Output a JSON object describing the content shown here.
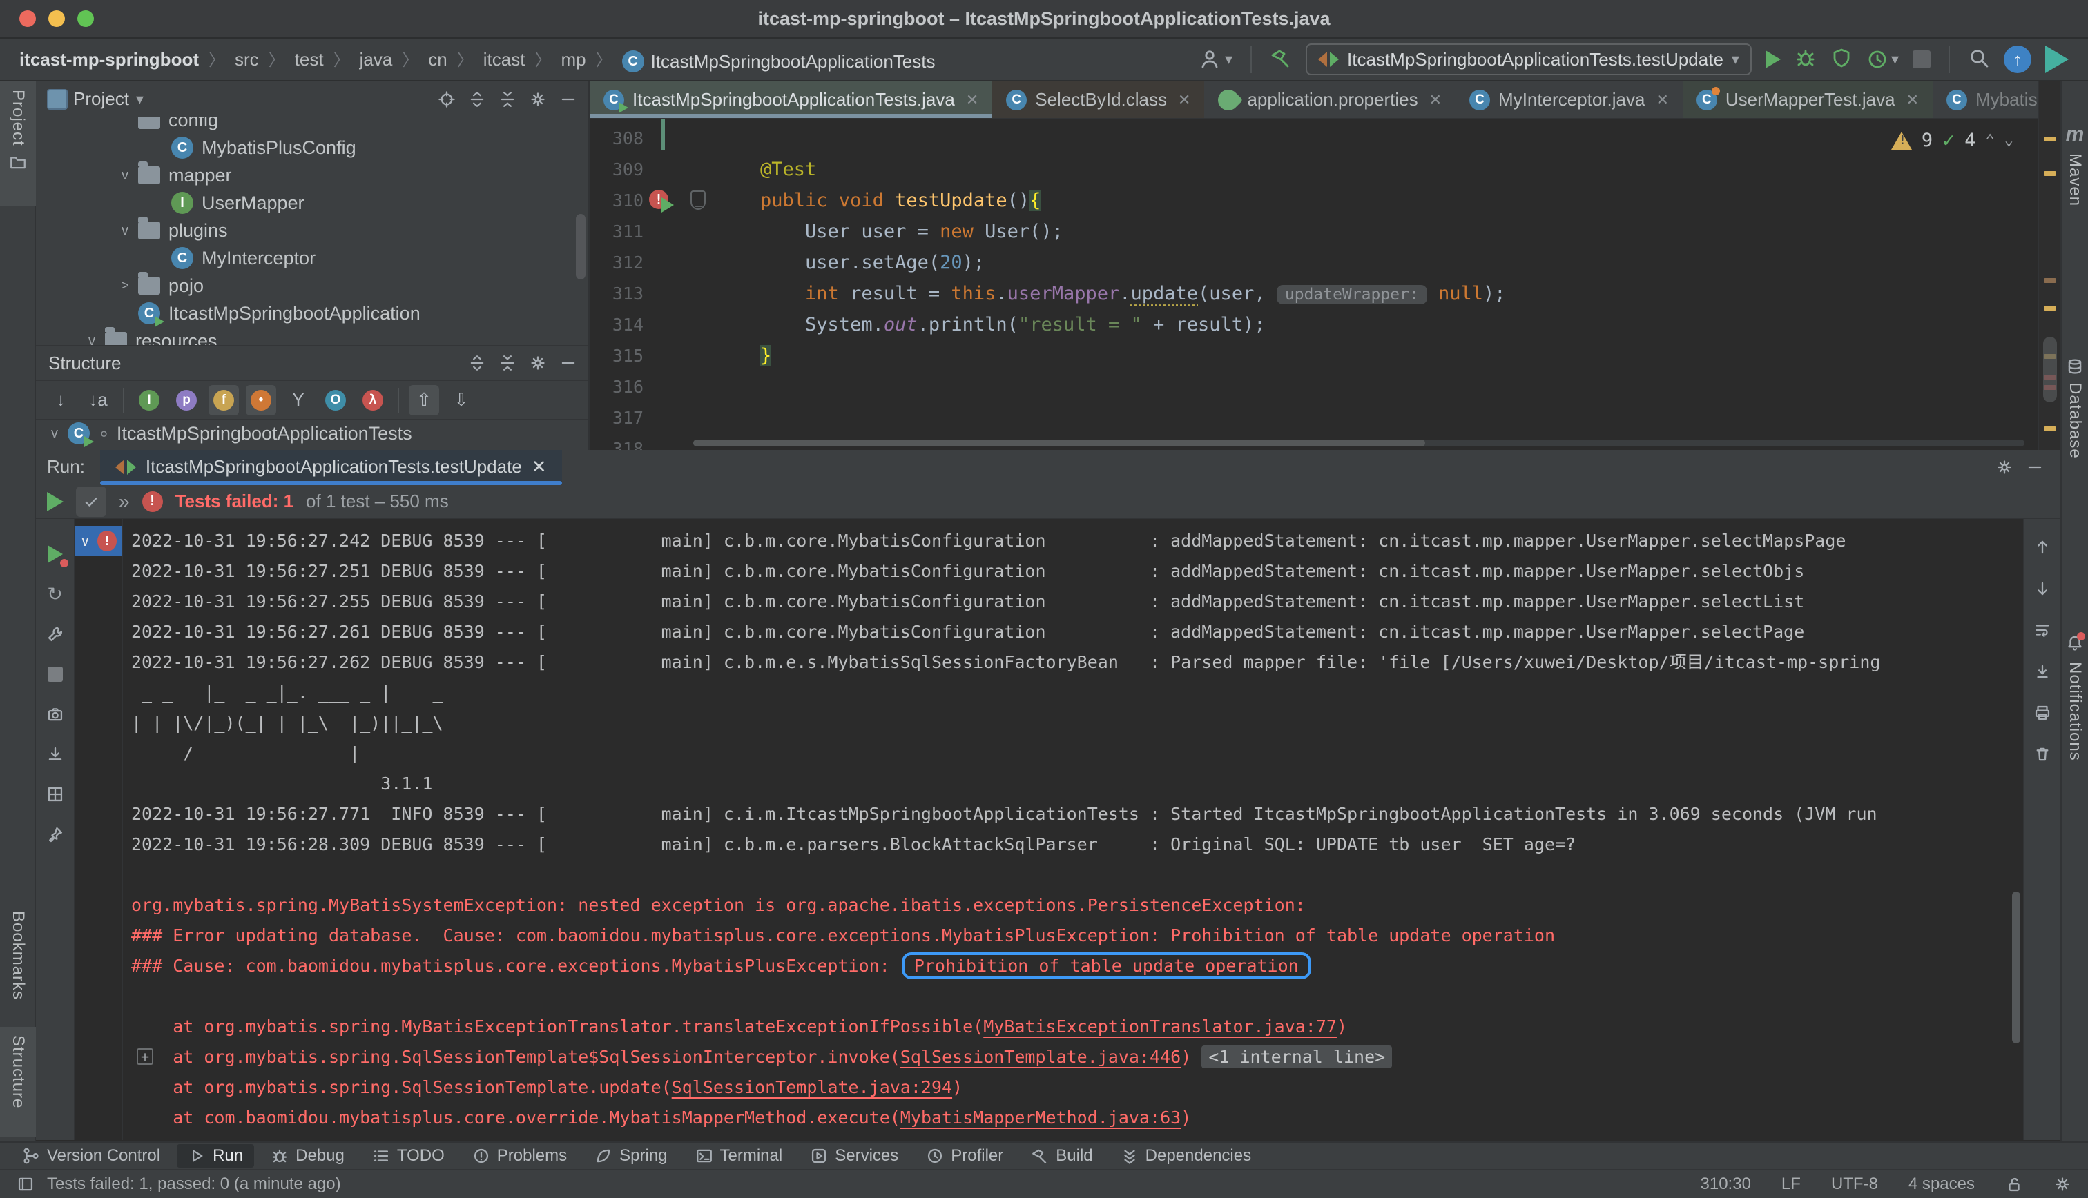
{
  "window": {
    "title": "itcast-mp-springboot – ItcastMpSpringbootApplicationTests.java"
  },
  "breadcrumb": {
    "root": "itcast-mp-springboot",
    "items": [
      "src",
      "test",
      "java",
      "cn",
      "itcast",
      "mp"
    ],
    "leaf": "ItcastMpSpringbootApplicationTests"
  },
  "toolbar": {
    "run_config": "ItcastMpSpringbootApplicationTests.testUpdate"
  },
  "left_stripe": {
    "project": "Project",
    "bookmarks": "Bookmarks",
    "structure": "Structure"
  },
  "right_stripe": {
    "maven_glyph": "m",
    "maven": "Maven",
    "database": "Database",
    "notifications": "Notifications"
  },
  "project_panel": {
    "title": "Project",
    "tree": [
      {
        "label": "config",
        "icon": "folder",
        "depth": 2,
        "chevron": "",
        "cut": true
      },
      {
        "label": "MybatisPlusConfig",
        "icon": "class",
        "depth": 3,
        "chevron": ""
      },
      {
        "label": "mapper",
        "icon": "folder",
        "depth": 2,
        "chevron": "v"
      },
      {
        "label": "UserMapper",
        "icon": "interface",
        "depth": 3,
        "chevron": ""
      },
      {
        "label": "plugins",
        "icon": "folder",
        "depth": 2,
        "chevron": "v"
      },
      {
        "label": "MyInterceptor",
        "icon": "class",
        "depth": 3,
        "chevron": ""
      },
      {
        "label": "pojo",
        "icon": "folder",
        "depth": 2,
        "chevron": ">"
      },
      {
        "label": "ItcastMpSpringbootApplication",
        "icon": "springboot",
        "depth": 2,
        "chevron": ""
      },
      {
        "label": "resources",
        "icon": "resources",
        "depth": 1,
        "chevron": "v"
      }
    ]
  },
  "structure_panel": {
    "title": "Structure",
    "root": "ItcastMpSpringbootApplicationTests",
    "filters": [
      {
        "name": "sort-by-visibility",
        "kind": "glyph",
        "glyph": "↓",
        "active": false
      },
      {
        "name": "sort-alphabetically",
        "kind": "glyph",
        "glyph": "↓a",
        "active": false
      },
      {
        "name": "sep1",
        "kind": "sep"
      },
      {
        "name": "show-inherited",
        "kind": "circle",
        "letter": "I",
        "bg": "#5f9955",
        "active": false
      },
      {
        "name": "show-properties",
        "kind": "circle",
        "letter": "p",
        "bg": "#8e7cc3",
        "active": false
      },
      {
        "name": "show-fields",
        "kind": "circle",
        "letter": "f",
        "bg": "#c8a452",
        "active": true
      },
      {
        "name": "show-non-public",
        "kind": "circle",
        "letter": "•",
        "bg": "#cf7836",
        "active": true
      },
      {
        "name": "show-anonymous",
        "kind": "glyph",
        "glyph": "Y",
        "active": false
      },
      {
        "name": "show-objects",
        "kind": "circle",
        "letter": "O",
        "bg": "#3f8ea8",
        "active": false
      },
      {
        "name": "show-lambdas",
        "kind": "circle",
        "letter": "λ",
        "bg": "#c75450",
        "active": false
      },
      {
        "name": "sep2",
        "kind": "sep"
      },
      {
        "name": "group-by-super",
        "kind": "glyph",
        "glyph": "⇧",
        "active": true
      },
      {
        "name": "sort-by-type",
        "kind": "glyph",
        "glyph": "⇩",
        "active": false
      }
    ]
  },
  "editor": {
    "tabs": [
      {
        "label": "ItcastMpSpringbootApplicationTests.java",
        "icon": "testclass",
        "close": true,
        "active": true
      },
      {
        "label": "SelectById.class",
        "icon": "class",
        "close": true,
        "tint": "warm"
      },
      {
        "label": "application.properties",
        "icon": "spring",
        "close": true
      },
      {
        "label": "MyInterceptor.java",
        "icon": "class",
        "close": true
      },
      {
        "label": "UserMapperTest.java",
        "icon": "classmod",
        "close": true,
        "tint": "greenish"
      },
      {
        "label": "MybatisPlusConfig.java",
        "icon": "class",
        "close": false,
        "dim": true
      }
    ],
    "inspections": {
      "warnings": "9",
      "weak_warnings": "4"
    },
    "code_lines": [
      {
        "n": "308",
        "tokens": []
      },
      {
        "n": "309",
        "tokens": [
          {
            "k": "ann",
            "s": "    @Test"
          }
        ]
      },
      {
        "n": "310",
        "run": true,
        "fold": true,
        "chg": true,
        "tokens": [
          {
            "k": "kw",
            "s": "    public void "
          },
          {
            "k": "mth",
            "s": "testUpdate"
          },
          {
            "k": "pl",
            "s": "()"
          },
          {
            "k": "brace",
            "s": "{"
          }
        ]
      },
      {
        "n": "311",
        "chg": true,
        "tokens": [
          {
            "k": "pl",
            "s": "        User user = "
          },
          {
            "k": "kw",
            "s": "new"
          },
          {
            "k": "pl",
            "s": " User();"
          }
        ]
      },
      {
        "n": "312",
        "chg": true,
        "tokens": [
          {
            "k": "pl",
            "s": "        user.setAge("
          },
          {
            "k": "num",
            "s": "20"
          },
          {
            "k": "pl",
            "s": ");"
          }
        ]
      },
      {
        "n": "313",
        "chg": true,
        "tokens": [
          {
            "k": "kw",
            "s": "        int"
          },
          {
            "k": "pl",
            "s": " result = "
          },
          {
            "k": "kw",
            "s": "this"
          },
          {
            "k": "pl",
            "s": "."
          },
          {
            "k": "fld",
            "s": "userMapper"
          },
          {
            "k": "pl",
            "s": "."
          },
          {
            "k": "warn",
            "s": "update"
          },
          {
            "k": "pl",
            "s": "(user, "
          },
          {
            "k": "hint",
            "s": "updateWrapper:"
          },
          {
            "k": "pl",
            "s": " "
          },
          {
            "k": "kw",
            "s": "null"
          },
          {
            "k": "pl",
            "s": ");"
          }
        ]
      },
      {
        "n": "314",
        "chg": true,
        "tokens": [
          {
            "k": "pl",
            "s": "        System."
          },
          {
            "k": "fldi",
            "s": "out"
          },
          {
            "k": "pl",
            "s": ".println("
          },
          {
            "k": "str",
            "s": "\"result = \""
          },
          {
            "k": "pl",
            "s": " + result);"
          }
        ]
      },
      {
        "n": "315",
        "chg": true,
        "tokens": [
          {
            "k": "pl",
            "s": "    "
          },
          {
            "k": "brace",
            "s": "}"
          }
        ]
      },
      {
        "n": "316",
        "tokens": []
      },
      {
        "n": "317",
        "tokens": []
      },
      {
        "n": "318",
        "tokens": []
      }
    ]
  },
  "run_panel": {
    "label": "Run:",
    "tab": "ItcastMpSpringbootApplicationTests.testUpdate",
    "status_failed": "Tests failed: 1",
    "status_rest": "of 1 test – 550 ms",
    "left_icons": [
      "rerun-failed-tests",
      "rerun",
      "test-settings",
      "stop",
      "test-history",
      "import-results",
      "layout",
      "pin"
    ],
    "right_icons": [
      "scroll-up",
      "scroll-down",
      "soft-wrap",
      "scroll-to-end",
      "print",
      "clear-all"
    ],
    "console_lines": [
      {
        "parts": [
          {
            "k": "t",
            "s": "2022-10-31 19:56:27.242 DEBUG 8539 --- [           main] c.b.m.core.MybatisConfiguration          : addMappedStatement: cn.itcast.mp.mapper.UserMapper.selectMapsPage"
          }
        ]
      },
      {
        "parts": [
          {
            "k": "t",
            "s": "2022-10-31 19:56:27.251 DEBUG 8539 --- [           main] c.b.m.core.MybatisConfiguration          : addMappedStatement: cn.itcast.mp.mapper.UserMapper.selectObjs"
          }
        ]
      },
      {
        "parts": [
          {
            "k": "t",
            "s": "2022-10-31 19:56:27.255 DEBUG 8539 --- [           main] c.b.m.core.MybatisConfiguration          : addMappedStatement: cn.itcast.mp.mapper.UserMapper.selectList"
          }
        ]
      },
      {
        "parts": [
          {
            "k": "t",
            "s": "2022-10-31 19:56:27.261 DEBUG 8539 --- [           main] c.b.m.core.MybatisConfiguration          : addMappedStatement: cn.itcast.mp.mapper.UserMapper.selectPage"
          }
        ]
      },
      {
        "parts": [
          {
            "k": "t",
            "s": "2022-10-31 19:56:27.262 DEBUG 8539 --- [           main] c.b.m.e.s.MybatisSqlSessionFactoryBean   : Parsed mapper file: 'file [/Users/xuwei/Desktop/项目/itcast-mp-spring"
          }
        ]
      },
      {
        "parts": [
          {
            "k": "t",
            "s": " _ _   |_  _ _|_. ___ _ |    _ "
          }
        ]
      },
      {
        "parts": [
          {
            "k": "t",
            "s": "| | |\\/|_)(_| | |_\\  |_)||_|_\\ "
          }
        ]
      },
      {
        "parts": [
          {
            "k": "t",
            "s": "     /               |         "
          }
        ]
      },
      {
        "parts": [
          {
            "k": "t",
            "s": "                        3.1.1 "
          }
        ]
      },
      {
        "parts": [
          {
            "k": "t",
            "s": "2022-10-31 19:56:27.771  INFO 8539 --- [           main] c.i.m.ItcastMpSpringbootApplicationTests : Started ItcastMpSpringbootApplicationTests in 3.069 seconds (JVM run"
          }
        ]
      },
      {
        "parts": [
          {
            "k": "t",
            "s": "2022-10-31 19:56:28.309 DEBUG 8539 --- [           main] c.b.m.e.parsers.BlockAttackSqlParser     : Original SQL: UPDATE tb_user  SET age=?"
          }
        ]
      },
      {
        "parts": []
      },
      {
        "parts": [
          {
            "k": "e",
            "s": "org.mybatis.spring.MyBatisSystemException: nested exception is org.apache.ibatis.exceptions.PersistenceException: "
          }
        ]
      },
      {
        "parts": [
          {
            "k": "e",
            "s": "### Error updating database.  Cause: com.baomidou.mybatisplus.core.exceptions.MybatisPlusException: Prohibition of table update operation"
          }
        ]
      },
      {
        "parts": [
          {
            "k": "e",
            "s": "### Cause: com.baomidou.mybatisplus.core.exceptions.MybatisPlusException: "
          },
          {
            "k": "b",
            "s": "Prohibition of table update operation"
          }
        ]
      },
      {
        "parts": []
      },
      {
        "parts": [
          {
            "k": "e",
            "s": "    at org.mybatis.spring.MyBatisExceptionTranslator.translateExceptionIfPossible("
          },
          {
            "k": "l",
            "s": "MyBatisExceptionTranslator.java:77"
          },
          {
            "k": "e",
            "s": ")"
          }
        ]
      },
      {
        "gutter": "plus",
        "parts": [
          {
            "k": "e",
            "s": "    at org.mybatis.spring.SqlSessionTemplate$SqlSessionInterceptor.invoke("
          },
          {
            "k": "l",
            "s": "SqlSessionTemplate.java:446"
          },
          {
            "k": "e",
            "s": ") "
          },
          {
            "k": "c",
            "s": "<1 internal line>"
          }
        ]
      },
      {
        "parts": [
          {
            "k": "e",
            "s": "    at org.mybatis.spring.SqlSessionTemplate.update("
          },
          {
            "k": "l",
            "s": "SqlSessionTemplate.java:294"
          },
          {
            "k": "e",
            "s": ")"
          }
        ]
      },
      {
        "parts": [
          {
            "k": "e",
            "s": "    at com.baomidou.mybatisplus.core.override.MybatisMapperMethod.execute("
          },
          {
            "k": "l",
            "s": "MybatisMapperMethod.java:63"
          },
          {
            "k": "e",
            "s": ")"
          }
        ]
      }
    ]
  },
  "bottom_bar": {
    "items": [
      {
        "label": "Version Control",
        "icon": "branch"
      },
      {
        "label": "Run",
        "icon": "play",
        "active": true
      },
      {
        "label": "Debug",
        "icon": "bug"
      },
      {
        "label": "TODO",
        "icon": "list"
      },
      {
        "label": "Problems",
        "icon": "problem"
      },
      {
        "label": "Spring",
        "icon": "leaf"
      },
      {
        "label": "Terminal",
        "icon": "terminal"
      },
      {
        "label": "Services",
        "icon": "services"
      },
      {
        "label": "Profiler",
        "icon": "clock"
      },
      {
        "label": "Build",
        "icon": "hammer"
      },
      {
        "label": "Dependencies",
        "icon": "deps"
      }
    ]
  },
  "status_bar": {
    "left": "Tests failed: 1, passed: 0 (a minute ago)",
    "position": "310:30",
    "line_ending": "LF",
    "encoding": "UTF-8",
    "indent": "4 spaces"
  },
  "colors": {
    "console_error": "#ff6b68",
    "highlight_box_blue": "#3d99f6",
    "run_tab_underline": "#3f7ecc",
    "selection_blue": "#356bb0",
    "warning_yellow": "#d6ae58",
    "ok_green": "#5fad65"
  }
}
